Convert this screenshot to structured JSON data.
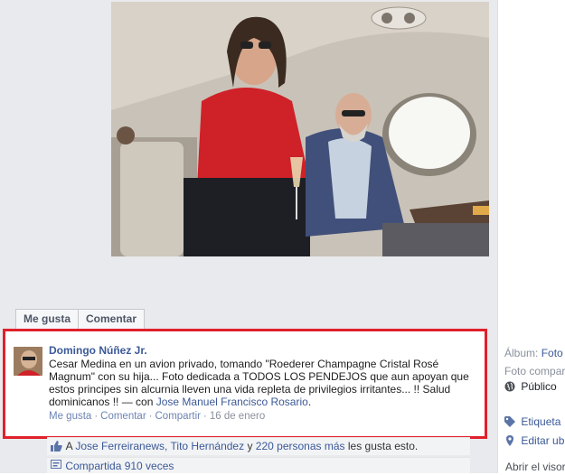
{
  "actions": {
    "like_label": "Me gusta",
    "comment_label": "Comentar"
  },
  "post": {
    "author": "Domingo Núñez Jr.",
    "body": "Cesar Medina en un avion privado, tomando \"Roederer Champagne Cristal Rosé Magnum\" con su hija... Foto dedicada a TODOS LOS PENDEJOS que aun apoyan que estos principes sin alcurnia lleven una vida repleta de privilegios irritantes... !! Salud dominicanos !!",
    "with_prefix": "— con",
    "with_name": "Jose Manuel Francisco Rosario",
    "with_suffix": ".",
    "meta": {
      "like": "Me gusta",
      "comment": "Comentar",
      "share": "Compartir",
      "date": "16 de enero"
    }
  },
  "likes": {
    "prefix": "A",
    "people": "Jose Ferreiranews, Tito Hernández",
    "connector": "y",
    "others": "220 personas más",
    "suffix": "les gusta esto."
  },
  "shares": {
    "text": "Compartida 910 veces"
  },
  "sidebar": {
    "album_label": "Álbum:",
    "album_value": "Foto",
    "shared_label": "Foto compar",
    "privacy": "Público",
    "tag": "Etiqueta",
    "edit": "Editar ub",
    "open_viewer": "Abrir el visor"
  },
  "colors": {
    "highlight_border": "#e0202b",
    "link": "#3b5998",
    "panel_bg": "#e9eaed"
  }
}
